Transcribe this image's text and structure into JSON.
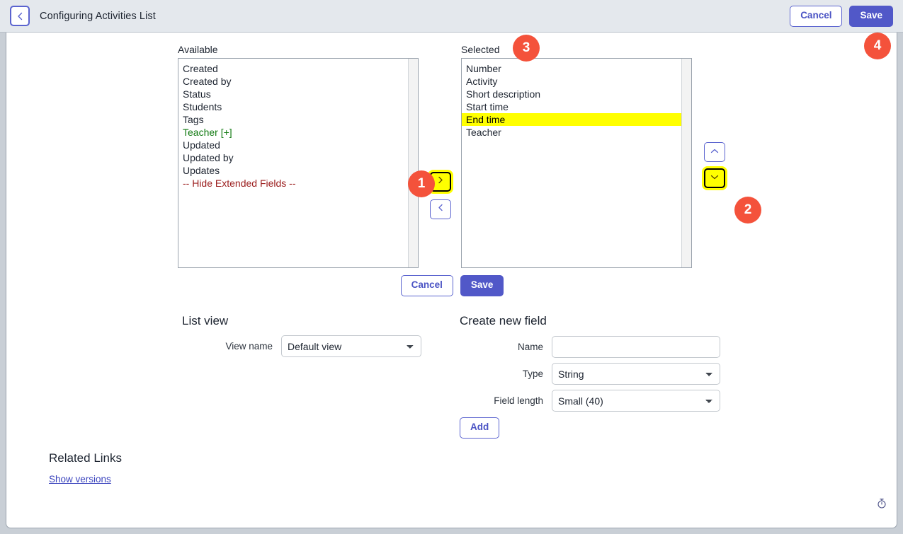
{
  "header": {
    "back_icon": "chevron-left-icon",
    "title": "Configuring Activities List",
    "cancel_label": "Cancel",
    "save_label": "Save"
  },
  "slushbucket": {
    "available_label": "Available",
    "selected_label": "Selected",
    "available_items": [
      {
        "label": "Created",
        "style": "normal"
      },
      {
        "label": "Created by",
        "style": "normal"
      },
      {
        "label": "Status",
        "style": "normal"
      },
      {
        "label": "Students",
        "style": "normal"
      },
      {
        "label": "Tags",
        "style": "normal"
      },
      {
        "label": "Teacher [+]",
        "style": "green"
      },
      {
        "label": "Updated",
        "style": "normal"
      },
      {
        "label": "Updated by",
        "style": "normal"
      },
      {
        "label": "Updates",
        "style": "normal"
      },
      {
        "label": "-- Hide Extended Fields --",
        "style": "red"
      }
    ],
    "selected_items": [
      {
        "label": "Number",
        "style": "normal"
      },
      {
        "label": "Activity",
        "style": "normal"
      },
      {
        "label": "Short description",
        "style": "normal"
      },
      {
        "label": "Start time",
        "style": "normal"
      },
      {
        "label": "End time",
        "style": "highlighted"
      },
      {
        "label": "Teacher",
        "style": "normal"
      }
    ],
    "add_icon": "chevron-right-icon",
    "remove_icon": "chevron-left-icon",
    "move_up_icon": "chevron-up-icon",
    "move_down_icon": "chevron-down-icon",
    "cancel_label": "Cancel",
    "save_label": "Save"
  },
  "badges": [
    {
      "number": "1"
    },
    {
      "number": "2"
    },
    {
      "number": "3"
    },
    {
      "number": "4"
    }
  ],
  "list_view": {
    "title": "List view",
    "view_name_label": "View name",
    "view_name_value": "Default view",
    "view_name_options": [
      "Default view"
    ]
  },
  "create_field": {
    "title": "Create new field",
    "name_label": "Name",
    "name_value": "",
    "name_placeholder": "",
    "type_label": "Type",
    "type_value": "String",
    "type_options": [
      "String"
    ],
    "field_length_label": "Field length",
    "field_length_value": "Small (40)",
    "field_length_options": [
      "Small (40)"
    ],
    "add_label": "Add"
  },
  "related_links": {
    "title": "Related Links",
    "links": [
      {
        "label": "Show versions"
      }
    ]
  },
  "footer": {
    "icon": "stopwatch-icon"
  },
  "colors": {
    "accent": "#5158c8",
    "highlight": "#ffff00",
    "badge": "#f4523b",
    "available_green": "#117a11",
    "available_red": "#9a1b1b",
    "link": "#3a43bd"
  }
}
